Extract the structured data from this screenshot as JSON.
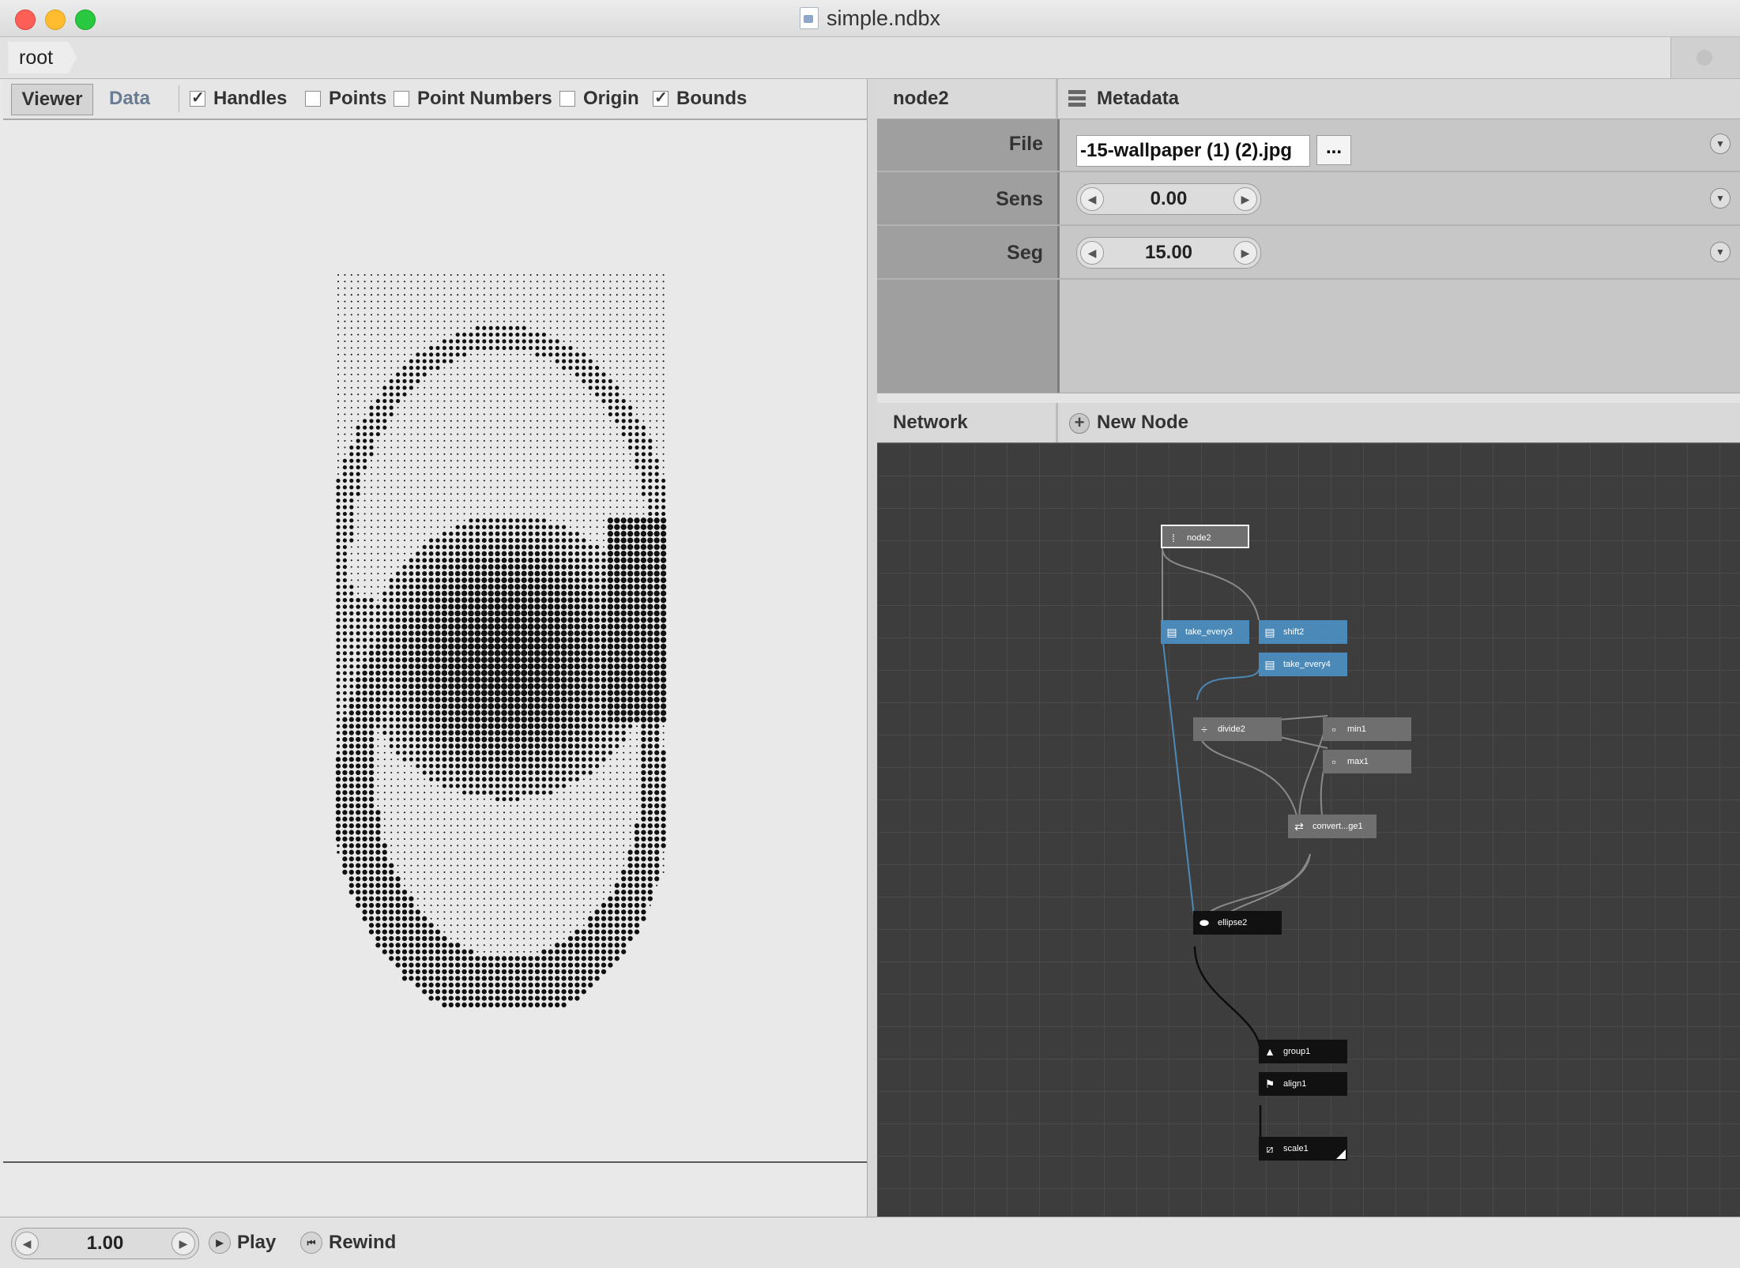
{
  "window": {
    "title": "simple.ndbx"
  },
  "breadcrumb": {
    "root": "root"
  },
  "viewer": {
    "tabs": {
      "viewer": "Viewer",
      "data": "Data"
    },
    "checks": [
      {
        "label": "Handles",
        "checked": true
      },
      {
        "label": "Points",
        "checked": false
      },
      {
        "label": "Point Numbers",
        "checked": false
      },
      {
        "label": "Origin",
        "checked": false
      },
      {
        "label": "Bounds",
        "checked": true
      }
    ]
  },
  "properties": {
    "node_name": "node2",
    "metadata_label": "Metadata",
    "file": {
      "label": "File",
      "value": "-15-wallpaper (1) (2).jpg",
      "browse_label": "..."
    },
    "sens": {
      "label": "Sens",
      "value": "0.00"
    },
    "seg": {
      "label": "Seg",
      "value": "15.00"
    }
  },
  "network": {
    "title": "Network",
    "new_node_label": "New Node",
    "nodes": {
      "node2": "node2",
      "take_every3": "take_every3",
      "shift2": "shift2",
      "take_every4": "take_every4",
      "divide2": "divide2",
      "min1": "min1",
      "max1": "max1",
      "convert": "convert...ge1",
      "ellipse2": "ellipse2",
      "group1": "group1",
      "align1": "align1",
      "scale1": "scale1"
    }
  },
  "playback": {
    "frame": "1.00",
    "play_label": "Play",
    "rewind_label": "Rewind"
  }
}
